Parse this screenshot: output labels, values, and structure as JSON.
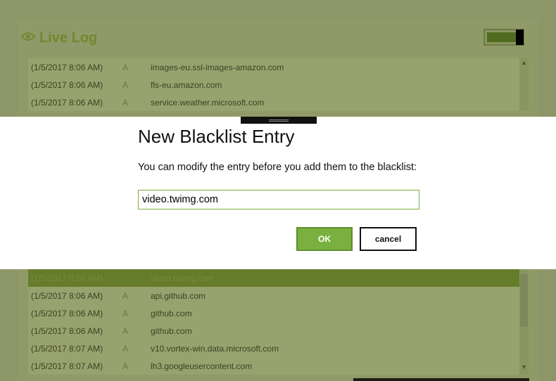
{
  "live_log": {
    "title": "Live Log",
    "toggle_on": true,
    "rows_top": [
      {
        "time": "(1/5/2017 8:06 AM)",
        "type": "A",
        "host": "images-eu.ssl-images-amazon.com"
      },
      {
        "time": "(1/5/2017 8:06 AM)",
        "type": "A",
        "host": "fls-eu.amazon.com"
      },
      {
        "time": "(1/5/2017 8:06 AM)",
        "type": "A",
        "host": "service.weather.microsoft.com"
      }
    ],
    "rows_bottom": [
      {
        "time": "(1/5/2017 8:06 AM)",
        "type": "A",
        "host": "video.twimg.com",
        "selected": true
      },
      {
        "time": "(1/5/2017 8:06 AM)",
        "type": "A",
        "host": "api.github.com"
      },
      {
        "time": "(1/5/2017 8:06 AM)",
        "type": "A",
        "host": "github.com"
      },
      {
        "time": "(1/5/2017 8:06 AM)",
        "type": "A",
        "host": "github.com"
      },
      {
        "time": "(1/5/2017 8:07 AM)",
        "type": "A",
        "host": "v10.vortex-win.data.microsoft.com"
      },
      {
        "time": "(1/5/2017 8:07 AM)",
        "type": "A",
        "host": "lh3.googleusercontent.com"
      }
    ]
  },
  "dialog": {
    "title": "New Blacklist Entry",
    "message": "You can modify the entry before you add them to the blacklist:",
    "entry_value": "video.twimg.com",
    "ok_label": "OK",
    "cancel_label": "cancel"
  },
  "colors": {
    "accent": "#7ab040",
    "overlay": "#8c9668",
    "selected_row": "#657c2a"
  },
  "icons": {
    "log": "eye-icon",
    "scroll_up": "triangle-up-icon",
    "scroll_down": "triangle-down-icon"
  }
}
